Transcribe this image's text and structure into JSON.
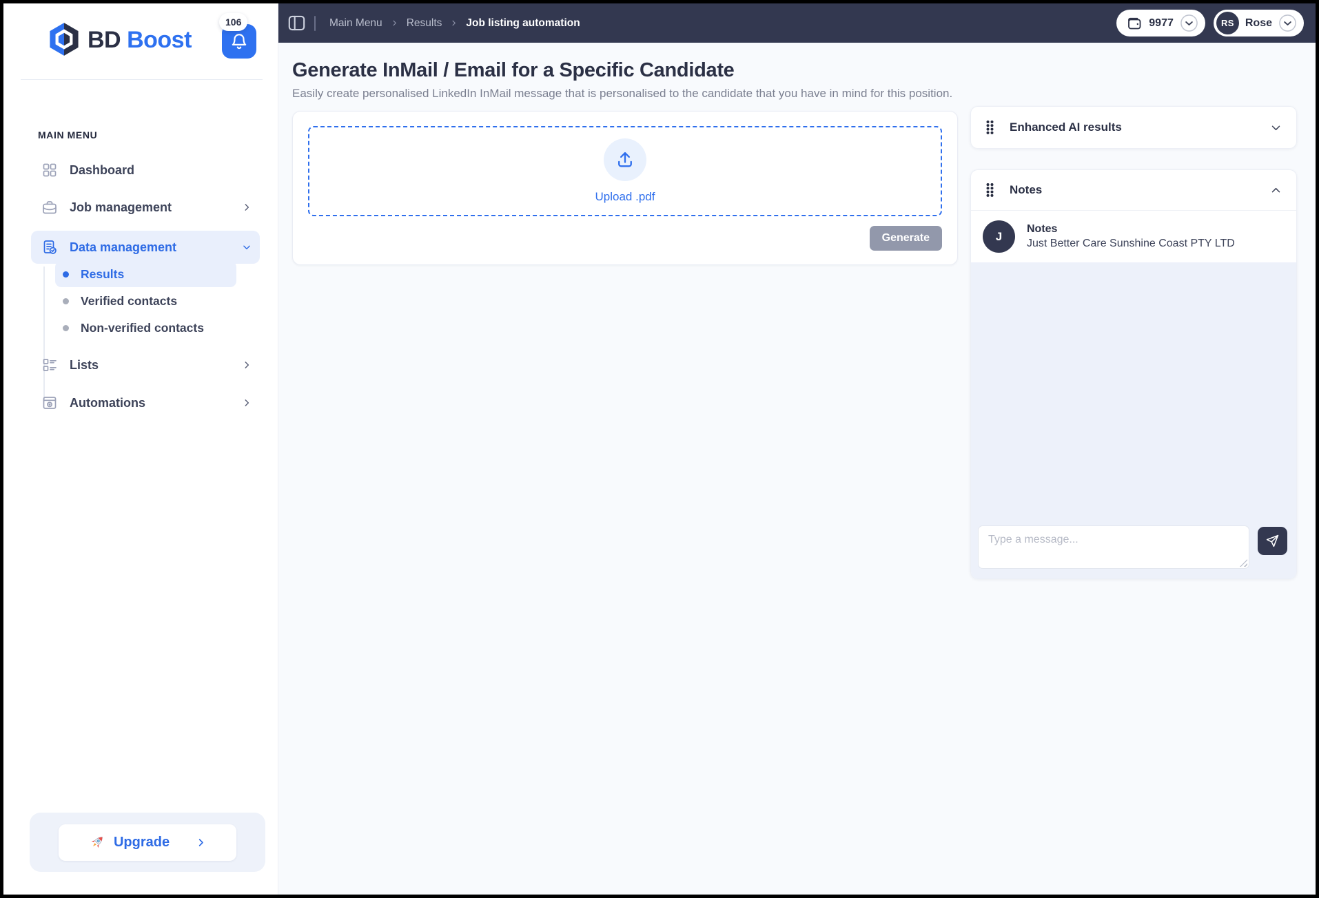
{
  "colors": {
    "accent_blue": "#2e6be5",
    "logo_blue": "#2e71f0",
    "navbar_navy": "#333850",
    "heading_navy": "#2b3045",
    "muted_grey": "#7a7f90",
    "active_item_bg": "#e9effc",
    "chat_bg": "#edf1fa",
    "generate_grey": "#9298ab",
    "upload_dashed_blue": "#2f6fed"
  },
  "brand": {
    "bd": "BD",
    "boost": "Boost",
    "notification_count": "106",
    "logo_icon": "hexagon-cube-logo",
    "bell_icon": "bell-icon"
  },
  "topbar": {
    "breadcrumb": {
      "root": "Main Menu",
      "section": "Results",
      "current": "Job listing automation"
    },
    "credits": "9977",
    "user": {
      "initials": "RS",
      "name": "Rose"
    }
  },
  "sidebar": {
    "section_label": "MAIN MENU",
    "menu": [
      {
        "label": "Dashboard",
        "icon": "dashboard-grid-icon"
      },
      {
        "label": "Job management",
        "icon": "briefcase-icon"
      },
      {
        "label": "Data management",
        "icon": "document-check-icon",
        "active": true
      },
      {
        "label": "Results",
        "active": true
      },
      {
        "label": "Verified contacts"
      },
      {
        "label": "Non-verified contacts"
      },
      {
        "label": "Lists",
        "icon": "checklist-icon"
      },
      {
        "label": "Automations",
        "icon": "automation-window-icon"
      }
    ],
    "upgrade_label": "Upgrade",
    "rocket_icon": "rocket-icon"
  },
  "main": {
    "title": "Generate InMail / Email for a Specific Candidate",
    "subtitle": "Easily create personalised LinkedIn InMail message that is personalised to the candidate that you have in mind for this position.",
    "upload_label": "Upload .pdf",
    "upload_icon": "upload-arrow-icon",
    "generate_label": "Generate"
  },
  "panels": {
    "enhanced_ai": {
      "title": "Enhanced AI results"
    },
    "notes": {
      "title": "Notes",
      "thread": {
        "avatar_initial": "J",
        "title": "Notes",
        "subtitle": "Just Better Care Sunshine Coast PTY LTD"
      },
      "composer": {
        "placeholder": "Type a message...",
        "send_icon": "paper-plane-icon"
      }
    }
  }
}
